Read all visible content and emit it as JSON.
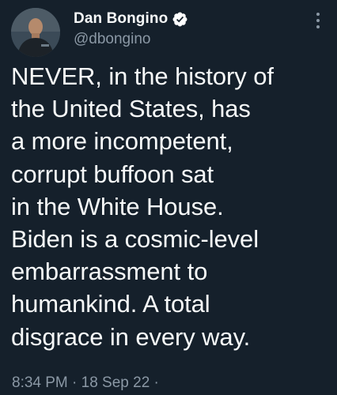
{
  "tweet": {
    "author": {
      "display_name": "Dan Bongino",
      "handle": "@dbongino",
      "verified": true,
      "avatar_icon": "profile-photo"
    },
    "more_icon": "vertical-ellipsis-icon",
    "text": "NEVER, in the history of\nthe United States, has\na more incompetent,\ncorrupt buffoon sat\nin the White House.\nBiden is a cosmic-level\nembarrassment to\nhumankind. A total\ndisgrace in every way.",
    "meta": {
      "time": "8:34 PM",
      "date": "18 Sep 22",
      "line": "8:34 PM · 18 Sep 22 ·"
    },
    "colors": {
      "background": "#15202b",
      "primary_text": "#f7f9f9",
      "secondary_text": "#8b98a5",
      "verified_badge": "#ffffff"
    }
  }
}
